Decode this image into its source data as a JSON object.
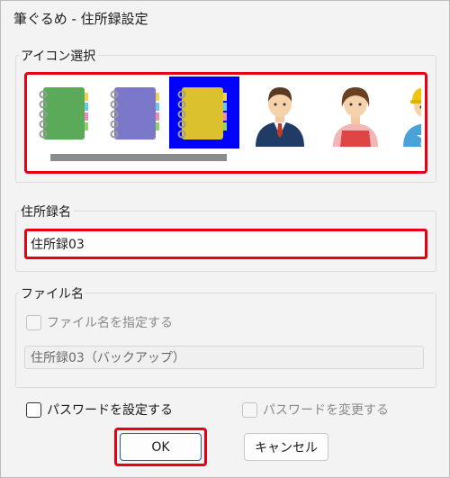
{
  "window": {
    "title": "筆ぐるめ - 住所録設定"
  },
  "icon_select": {
    "label": "アイコン選択",
    "icons": [
      {
        "name": "green-notebook-icon",
        "color": "#5aaa5a"
      },
      {
        "name": "purple-notebook-icon",
        "color": "#7b78c9"
      },
      {
        "name": "yellow-notebook-icon",
        "color": "#dcc12f",
        "selected": true
      },
      {
        "name": "businessman-icon"
      },
      {
        "name": "woman-apron-icon"
      },
      {
        "name": "worker-helmet-icon"
      }
    ],
    "selection_color": "#0000ff"
  },
  "address_book_name": {
    "label": "住所録名",
    "value": "住所録03"
  },
  "file_name": {
    "label": "ファイル名",
    "specify_checkbox_label": "ファイル名を指定する",
    "value": "住所録03（バックアップ）"
  },
  "password": {
    "set_label": "パスワードを設定する",
    "change_label": "パスワードを変更する"
  },
  "buttons": {
    "ok": "OK",
    "cancel": "キャンセル"
  },
  "highlight_color": "#e60012"
}
